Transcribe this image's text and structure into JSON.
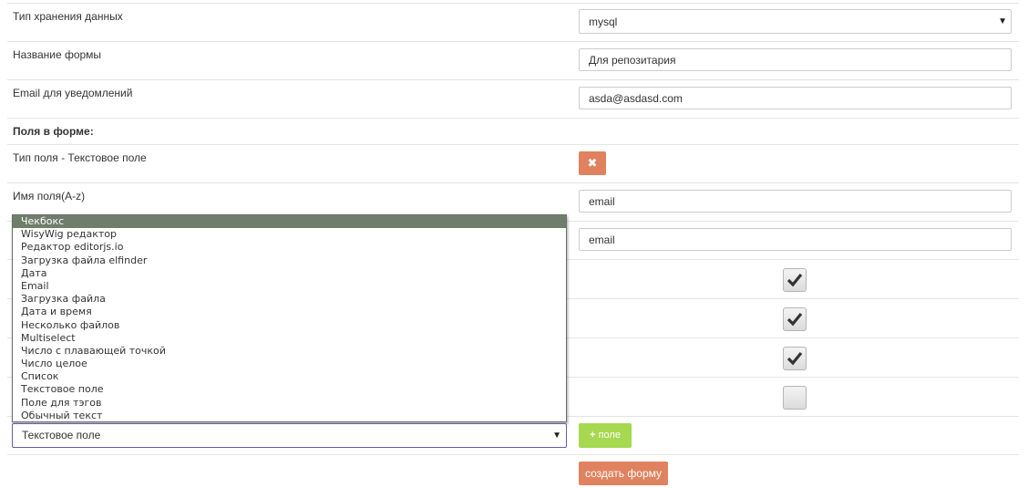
{
  "form": {
    "storage_type_label": "Тип хранения данных",
    "storage_type_value": "mysql",
    "form_name_label": "Название формы",
    "form_name_value": "Для репозитария",
    "email_label": "Email для уведомлений",
    "email_value": "asda@asdasd.com",
    "fields_heading": "Поля в форме:"
  },
  "field": {
    "type_label": "Тип поля - Текстовое поле",
    "delete_icon": "times-icon",
    "name_label": "Имя поля(A-z)",
    "name_value": "email",
    "second_value": "email",
    "checkboxes": [
      true,
      true,
      true,
      false
    ]
  },
  "type_dropdown": {
    "options": [
      "Чекбокс",
      "WisyWig редактор",
      "Редактор editorjs.io",
      "Загрузка файла elfinder",
      "Дата",
      "Email",
      "Загрузка файла",
      "Дата и время",
      "Несколько файлов",
      "Multiselect",
      "Число с плавающей точкой",
      "Число целое",
      "Список",
      "Текстовое поле",
      "Поле для тэгов",
      "Обычный текст"
    ],
    "highlighted_index": 0,
    "selected_value": "Текстовое поле"
  },
  "buttons": {
    "add_field_icon": "+",
    "add_field_label": "поле",
    "create_form_label": "создать форму"
  },
  "colors": {
    "danger": "#e0825f",
    "success": "#a6d94f",
    "highlight": "#6e7e6a"
  }
}
